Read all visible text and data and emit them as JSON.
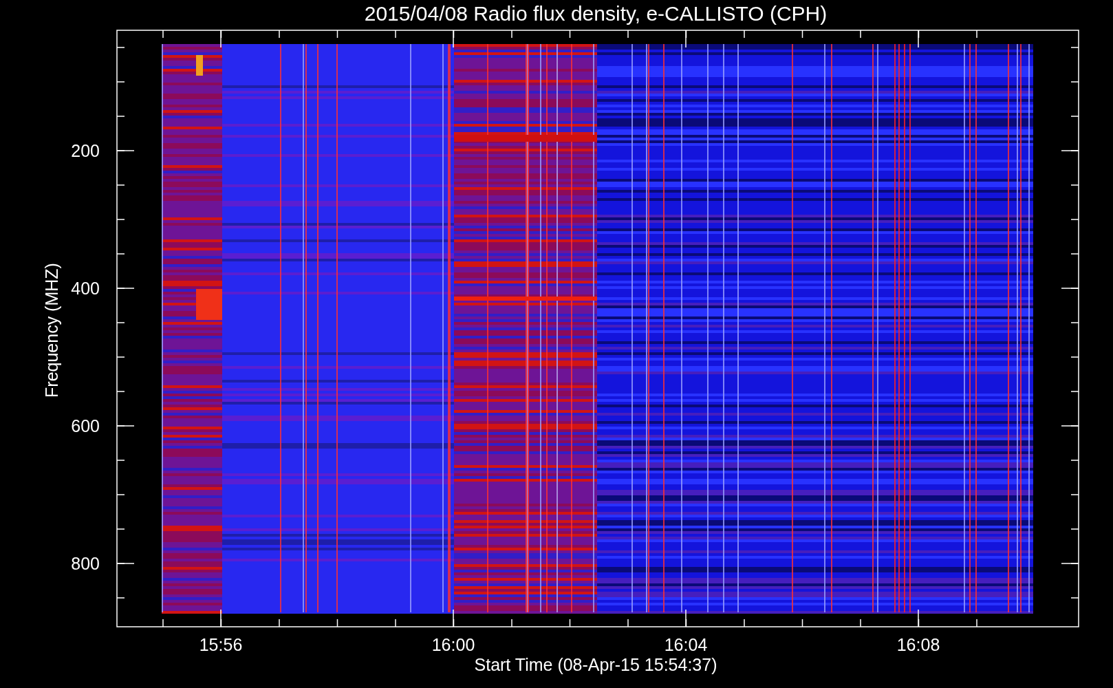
{
  "title": "2015/04/08  Radio flux density, e-CALLISTO (CPH)",
  "y_axis": {
    "label": "Frequency (MHZ)",
    "ticks": [
      "200",
      "400",
      "600",
      "800"
    ]
  },
  "x_axis": {
    "label": "Start Time (08-Apr-15 15:54:37)",
    "ticks": [
      "15:56",
      "16:00",
      "16:04",
      "16:08"
    ]
  }
}
